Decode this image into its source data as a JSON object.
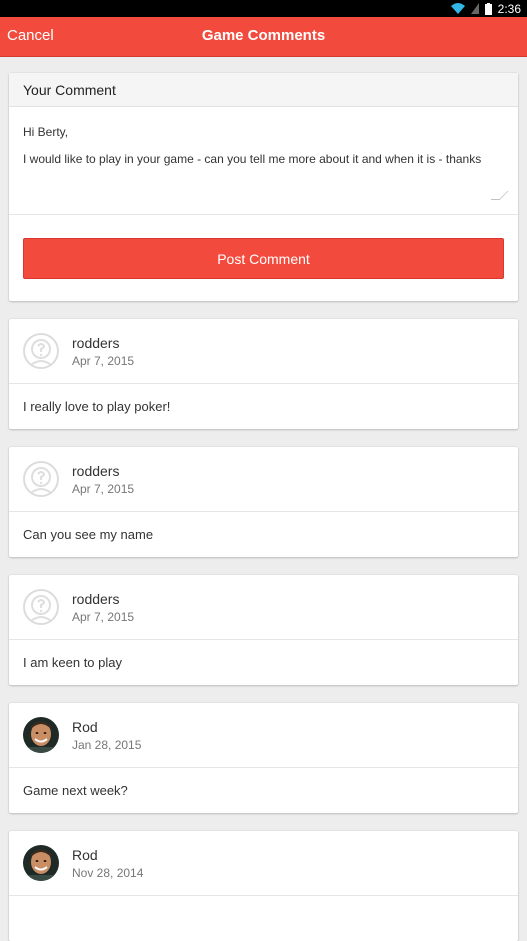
{
  "status": {
    "time": "2:36"
  },
  "appbar": {
    "cancel_label": "Cancel",
    "title": "Game Comments"
  },
  "compose": {
    "header": "Your Comment",
    "text_value": "Hi Berty,\nI would like to play in your game - can you tell me more about it and when it is - thanks",
    "post_label": "Post Comment"
  },
  "comments": [
    {
      "author": "rodders",
      "date": "Apr 7, 2015",
      "text": "I really love to play poker!",
      "avatar": "placeholder"
    },
    {
      "author": "rodders",
      "date": "Apr 7, 2015",
      "text": "Can you see my name",
      "avatar": "placeholder"
    },
    {
      "author": "rodders",
      "date": "Apr 7, 2015",
      "text": "I am keen to play",
      "avatar": "placeholder"
    },
    {
      "author": "Rod",
      "date": "Jan 28, 2015",
      "text": "Game next week?",
      "avatar": "photo"
    },
    {
      "author": "Rod",
      "date": "Nov 28, 2014",
      "text": "",
      "avatar": "photo"
    }
  ],
  "colors": {
    "accent": "#f24b3d"
  }
}
